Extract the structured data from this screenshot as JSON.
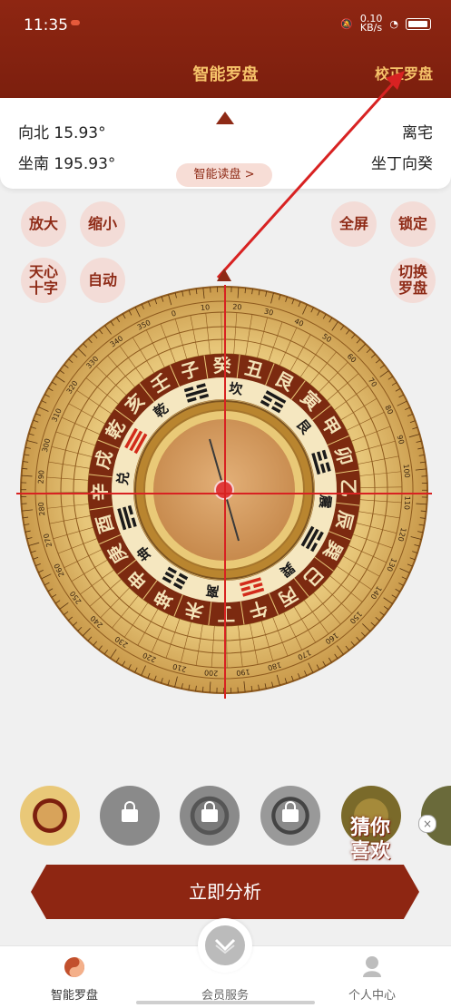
{
  "status": {
    "time": "11:35",
    "net_speed": "0.10\nKB/s"
  },
  "nav": {
    "title": "智能罗盘",
    "right": "校正罗盘"
  },
  "info": {
    "left_top": "向北  15.93°",
    "left_bottom": "坐南  195.93°",
    "right_top": "离宅",
    "right_bottom": "坐丁向癸",
    "read_button": "智能读盘 >"
  },
  "controls": {
    "zoom_in": "放大",
    "zoom_out": "缩小",
    "fullscreen": "全屏",
    "lock": "锁定",
    "crosshair": "天心\n十字",
    "auto": "自动",
    "switch": "切换\n罗盘"
  },
  "compass": {
    "rotation_deg": -15.93,
    "mountains": [
      "子",
      "癸",
      "丑",
      "艮",
      "寅",
      "甲",
      "卯",
      "乙",
      "辰",
      "巽",
      "巳",
      "丙",
      "午",
      "丁",
      "未",
      "坤",
      "申",
      "庚",
      "酉",
      "辛",
      "戌",
      "乾",
      "亥",
      "壬"
    ],
    "trigram_names": [
      "坎",
      "艮",
      "震",
      "巽",
      "离",
      "坤",
      "兑",
      "乾"
    ],
    "degree_labels": [
      "0",
      "10",
      "20",
      "30",
      "40",
      "50",
      "60",
      "70",
      "80",
      "90",
      "100",
      "110",
      "120",
      "130",
      "140",
      "150",
      "160",
      "170",
      "180",
      "190",
      "200",
      "210",
      "220",
      "230",
      "240",
      "250",
      "260",
      "270",
      "280",
      "290",
      "300",
      "310",
      "320",
      "330",
      "340",
      "350"
    ]
  },
  "promo": {
    "text": "猜你\n喜欢",
    "close": "×"
  },
  "analyze_button": "立即分析",
  "tabs": [
    {
      "label": "智能罗盘"
    },
    {
      "label": "会员服务"
    },
    {
      "label": "个人中心"
    }
  ],
  "colors": {
    "brand": "#8e2612",
    "gold": "#f6c36a",
    "crosshair": "#d82222"
  }
}
